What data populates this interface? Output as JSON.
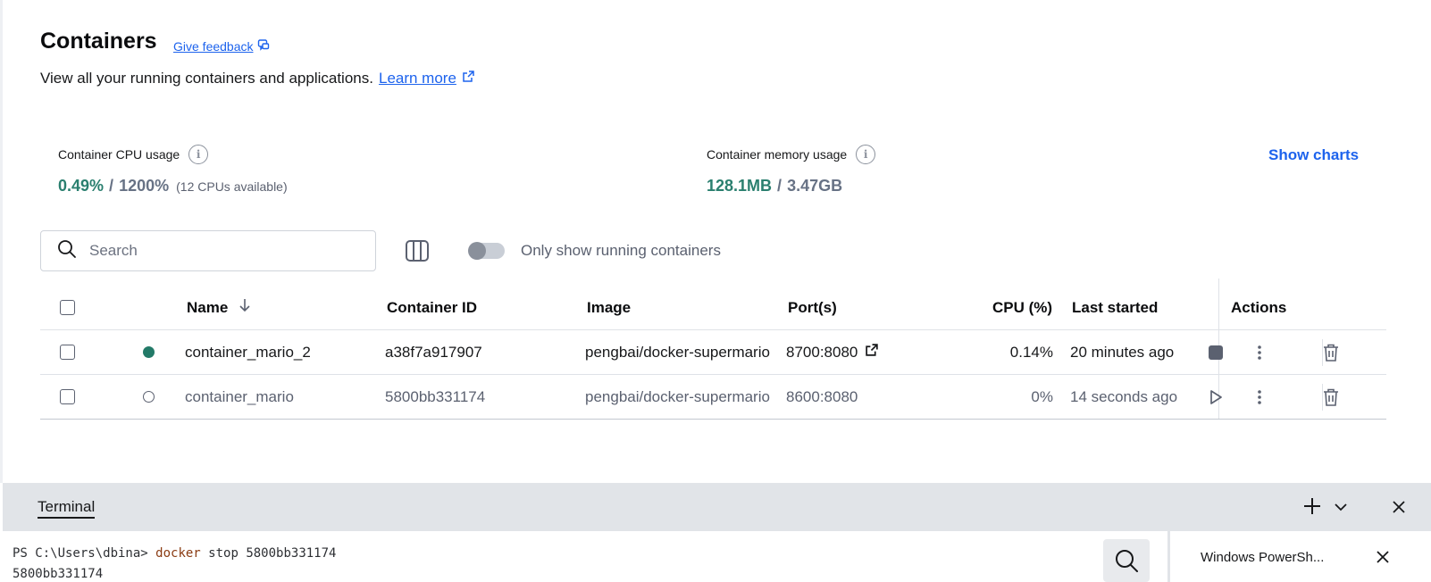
{
  "header": {
    "title": "Containers",
    "feedback_label": "Give feedback",
    "subtitle": "View all your running containers and applications.",
    "learn_more_label": "Learn more"
  },
  "stats": {
    "cpu": {
      "label": "Container CPU usage",
      "used": "0.49%",
      "separator": "/",
      "total": "1200%",
      "available": "(12 CPUs available)"
    },
    "memory": {
      "label": "Container memory usage",
      "used": "128.1MB",
      "separator": "/",
      "total": "3.47GB"
    },
    "show_charts_label": "Show charts"
  },
  "toolbar": {
    "search_placeholder": "Search",
    "toggle_label": "Only show running containers",
    "toggle_on": false
  },
  "table": {
    "columns": {
      "name": "Name",
      "container_id": "Container ID",
      "image": "Image",
      "ports": "Port(s)",
      "cpu": "CPU (%)",
      "last_started": "Last started",
      "actions": "Actions"
    },
    "sort": {
      "column": "Name",
      "direction": "descending"
    },
    "rows": [
      {
        "status": "running",
        "name": "container_mario_2",
        "container_id": "a38f7a917907",
        "image": "pengbai/docker-supermario",
        "ports": "8700:8080",
        "cpu": "0.14%",
        "last_started": "20 minutes ago"
      },
      {
        "status": "stopped",
        "name": "container_mario",
        "container_id": "5800bb331174",
        "image": "pengbai/docker-supermario",
        "ports": "8600:8080",
        "cpu": "0%",
        "last_started": "14 seconds ago"
      }
    ]
  },
  "terminal": {
    "title": "Terminal",
    "prompt": "PS C:\\Users\\dbina>",
    "command": "docker",
    "args": "stop 5800bb331174",
    "output": "5800bb331174",
    "tab_label": "Windows PowerSh..."
  },
  "colors": {
    "accent": "#1d63ed",
    "running": "#237a68",
    "stat_value": "#2a7f6f"
  }
}
